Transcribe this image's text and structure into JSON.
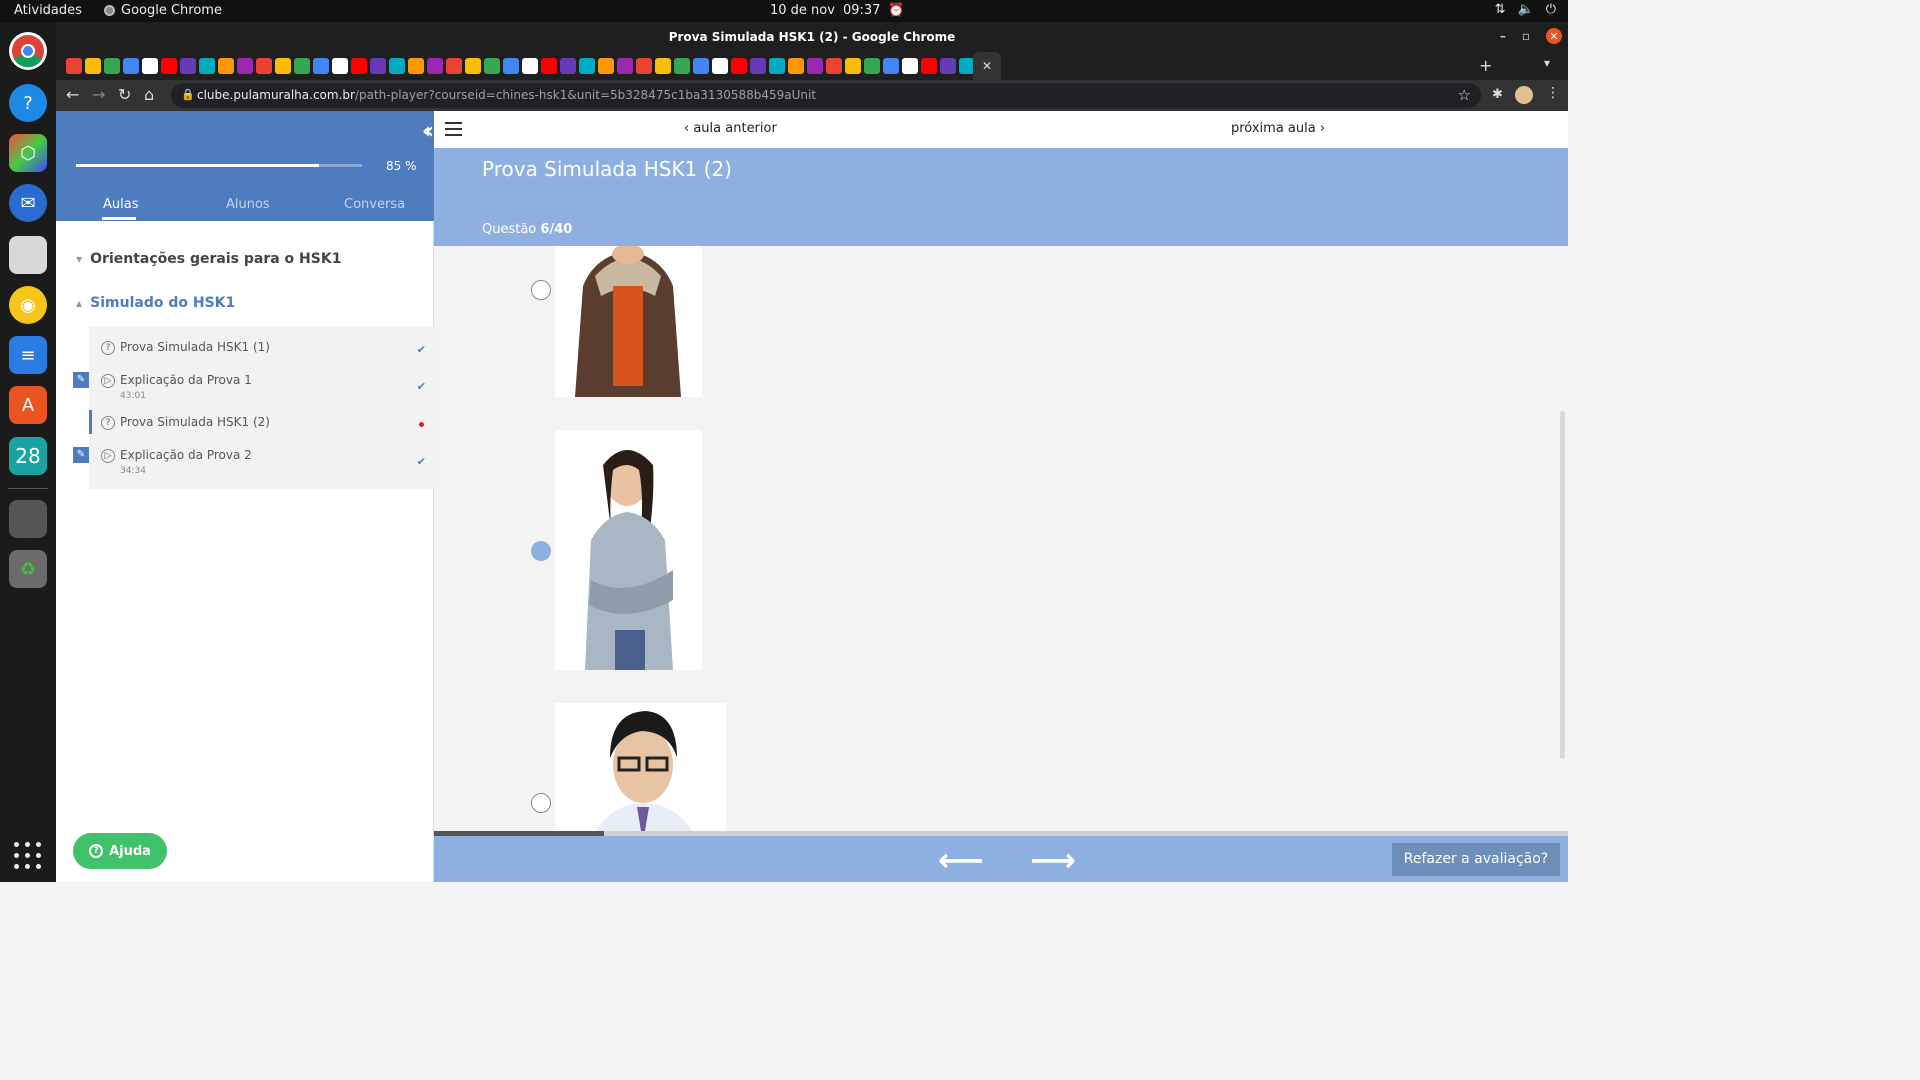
{
  "os": {
    "activities": "Atividades",
    "app_name": "Google Chrome",
    "date": "10 de nov",
    "time": "09:37",
    "dock_calendar_day": "28"
  },
  "browser": {
    "window_title": "Prova Simulada HSK1 (2) - Google Chrome",
    "url_host": "clube.pulamuralha.com.br",
    "url_path": "/path-player?courseid=chines-hsk1&unit=5b328475c1ba3130588b459aUnit"
  },
  "sidebar": {
    "progress": {
      "percent": 85,
      "label": "85 %"
    },
    "tabs": [
      {
        "label": "Aulas",
        "active": true
      },
      {
        "label": "Alunos",
        "active": false
      },
      {
        "label": "Conversa",
        "active": false
      }
    ],
    "sections": [
      {
        "title": "Orientações gerais para o HSK1",
        "expanded": false
      },
      {
        "title": "Simulado do HSK1",
        "expanded": true
      }
    ],
    "lessons": [
      {
        "title": "Prova Simulada HSK1 (1)",
        "duration": "",
        "type": "quiz",
        "status": "done"
      },
      {
        "title": "Explicação da Prova 1",
        "duration": "43:01",
        "type": "video",
        "status": "done"
      },
      {
        "title": "Prova Simulada HSK1 (2)",
        "duration": "",
        "type": "quiz",
        "status": "current"
      },
      {
        "title": "Explicação da Prova 2",
        "duration": "34:34",
        "type": "video",
        "status": "done"
      }
    ],
    "help_label": "Ajuda"
  },
  "main": {
    "prev_label": "aula anterior",
    "next_label": "próxima aula",
    "title": "Prova Simulada HSK1 (2)",
    "question_prefix": "Questão",
    "question_value": "6/40",
    "options": [
      {
        "image": "woman-in-brown-winter-coat",
        "selected": false
      },
      {
        "image": "woman-in-grey-cardigan-arms-crossed",
        "selected": true
      },
      {
        "image": "young-man-with-glasses",
        "selected": false
      }
    ],
    "redo_label": "Refazer a avaliação?"
  },
  "colors": {
    "sidebar_header": "#4f7cbe",
    "main_header": "#8eb0e1",
    "help_button": "#3fc26a",
    "current_dot": "#d62020"
  }
}
